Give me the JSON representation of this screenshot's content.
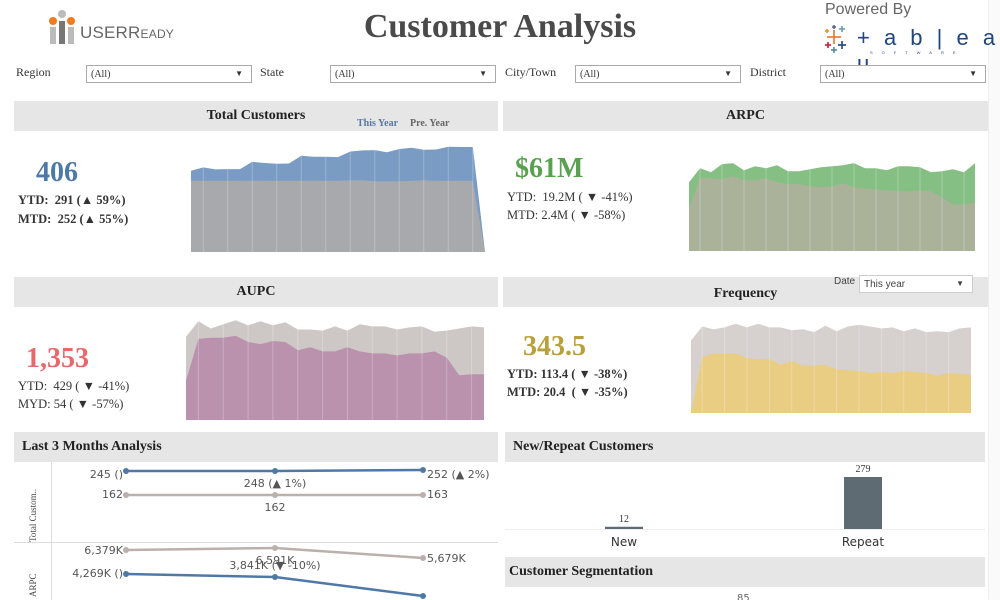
{
  "header": {
    "title": "Customer Analysis",
    "logo_text_main": "USER",
    "logo_text_small": "EADY",
    "logo_text_r": "R",
    "powered_by": "Powered By",
    "tableau_word": "+ a b | e a u",
    "tableau_sub": "SOFTWARE"
  },
  "filters": [
    {
      "label": "Region",
      "value": "(All)"
    },
    {
      "label": "State",
      "value": "(All)"
    },
    {
      "label": "City/Town",
      "value": "(All)"
    },
    {
      "label": "District",
      "value": "(All)"
    }
  ],
  "legend": {
    "this_year": "This Year",
    "prev_year": "Pre. Year"
  },
  "colors": {
    "customers_blue": "#4e79a7",
    "arpc_green": "#59a14f",
    "aupc_red": "#e15759",
    "frequency_gold": "#b8a03a",
    "prev_gray": "#a8a8ad",
    "bar_dark": "#5f6b73"
  },
  "panels": {
    "total_customers": {
      "title": "Total Customers",
      "value": "406",
      "line1": "YTD:  291 (▲ 59%)",
      "line2": "MTD:  252 (▲ 55%)"
    },
    "arpc": {
      "title": "ARPC",
      "value": "$61M",
      "line1": "YTD:  19.2M ( ▼ -41%)",
      "line2": "MTD: 2.4M ( ▼ -58%)"
    },
    "aupc": {
      "title": "AUPC",
      "value": "1,353",
      "line1": "YTD:  429 ( ▼ -41%)",
      "line2": "MYD: 54 ( ▼ -57%)"
    },
    "frequency": {
      "title": "Frequency",
      "value": "343.5",
      "line1": "YTD: 113.4 ( ▼ -38%)",
      "line2": "MTD: 20.4  ( ▼ -35%)",
      "date_label": "Date",
      "date_value": "This year"
    }
  },
  "chart_data": [
    {
      "type": "area",
      "title": "Total Customers",
      "series": [
        {
          "name": "This Year",
          "values": [
            290,
            302,
            295,
            296,
            296,
            322,
            318,
            315,
            316,
            344,
            340,
            340,
            339,
            359,
            363,
            364,
            356,
            368,
            372,
            365,
            366,
            376,
            375,
            375,
            0
          ]
        },
        {
          "name": "Pre. Year",
          "values": [
            254,
            254,
            254,
            254,
            254,
            255,
            254,
            254,
            254,
            254,
            255,
            254,
            254,
            256,
            256,
            253,
            252,
            253,
            254,
            256,
            254,
            254,
            254,
            254,
            0
          ]
        }
      ],
      "ylim": [
        0,
        400
      ]
    },
    {
      "type": "area",
      "title": "ARPC",
      "series": [
        {
          "name": "This Year",
          "values": [
            68,
            82,
            78,
            86,
            87,
            80,
            84,
            82,
            85,
            79,
            79,
            81,
            83,
            84,
            85,
            87,
            82,
            82,
            80,
            84,
            84,
            83,
            78,
            79,
            81,
            78,
            87
          ]
        },
        {
          "name": "Pre. Year",
          "values": [
            42,
            72,
            72,
            71,
            74,
            70,
            70,
            72,
            68,
            66,
            66,
            64,
            63,
            64,
            67,
            63,
            62,
            61,
            60,
            59,
            59,
            60,
            59,
            53,
            46,
            46,
            48
          ]
        }
      ],
      "ylim": [
        0,
        100
      ]
    },
    {
      "type": "area",
      "title": "AUPC",
      "series": [
        {
          "name": "This Year",
          "values": [
            80,
            95,
            88,
            92,
            96,
            91,
            95,
            91,
            94,
            87,
            87,
            86,
            90,
            86,
            92,
            90,
            90,
            87,
            89,
            90,
            85,
            86,
            88,
            90,
            89
          ]
        },
        {
          "name": "Pre. Year",
          "values": [
            38,
            78,
            79,
            79,
            81,
            75,
            73,
            76,
            75,
            67,
            70,
            66,
            66,
            70,
            66,
            64,
            64,
            62,
            64,
            64,
            66,
            60,
            43,
            44,
            44
          ]
        }
      ],
      "ylim": [
        0,
        100
      ]
    },
    {
      "type": "area",
      "title": "Frequency",
      "series": [
        {
          "name": "This Year",
          "values": [
            78,
            93,
            90,
            92,
            96,
            92,
            96,
            92,
            92,
            89,
            90,
            87,
            94,
            88,
            93,
            95,
            93,
            91,
            92,
            88,
            91,
            87,
            88,
            87,
            91,
            92
          ]
        },
        {
          "name": "Pre. Year",
          "values": [
            0,
            60,
            64,
            64,
            64,
            59,
            58,
            58,
            52,
            56,
            51,
            51,
            52,
            47,
            46,
            45,
            43,
            44,
            43,
            45,
            44,
            43,
            40,
            43,
            42,
            41
          ]
        }
      ],
      "ylim": [
        0,
        100
      ]
    },
    {
      "type": "line",
      "title": "Last 3 Months Analysis",
      "rows": [
        {
          "name": "Total Customers",
          "series": [
            {
              "name": "This Year",
              "values": [
                245,
                248,
                252
              ],
              "labels": [
                "245 ()",
                "248 (▲ 1%)",
                "252 (▲ 2%)"
              ]
            },
            {
              "name": "Pre. Year",
              "values": [
                162,
                162,
                163
              ],
              "labels": [
                "162",
                "162",
                "163"
              ]
            }
          ]
        },
        {
          "name": "ARPC",
          "series": [
            {
              "name": "Pre. Year",
              "values": [
                6379,
                6591,
                5679
              ],
              "labels": [
                "6,379K",
                "6,591K",
                "5,679K"
              ]
            },
            {
              "name": "This Year",
              "values": [
                4269,
                3841,
                2900
              ],
              "labels": [
                "4,269K ()",
                "3,841K (▼ -10%)",
                ""
              ]
            }
          ]
        }
      ]
    },
    {
      "type": "bar",
      "title": "New/Repeat Customers",
      "categories": [
        "New",
        "Repeat"
      ],
      "values": [
        12,
        279
      ]
    }
  ],
  "sections": {
    "last3": {
      "title": "Last 3 Months Analysis",
      "row_labels": [
        "Total Custom..",
        "ARPC"
      ]
    },
    "new_repeat": {
      "title": "New/Repeat Customers"
    },
    "segmentation": {
      "title": "Customer Segmentation",
      "partial_label": "85"
    }
  }
}
